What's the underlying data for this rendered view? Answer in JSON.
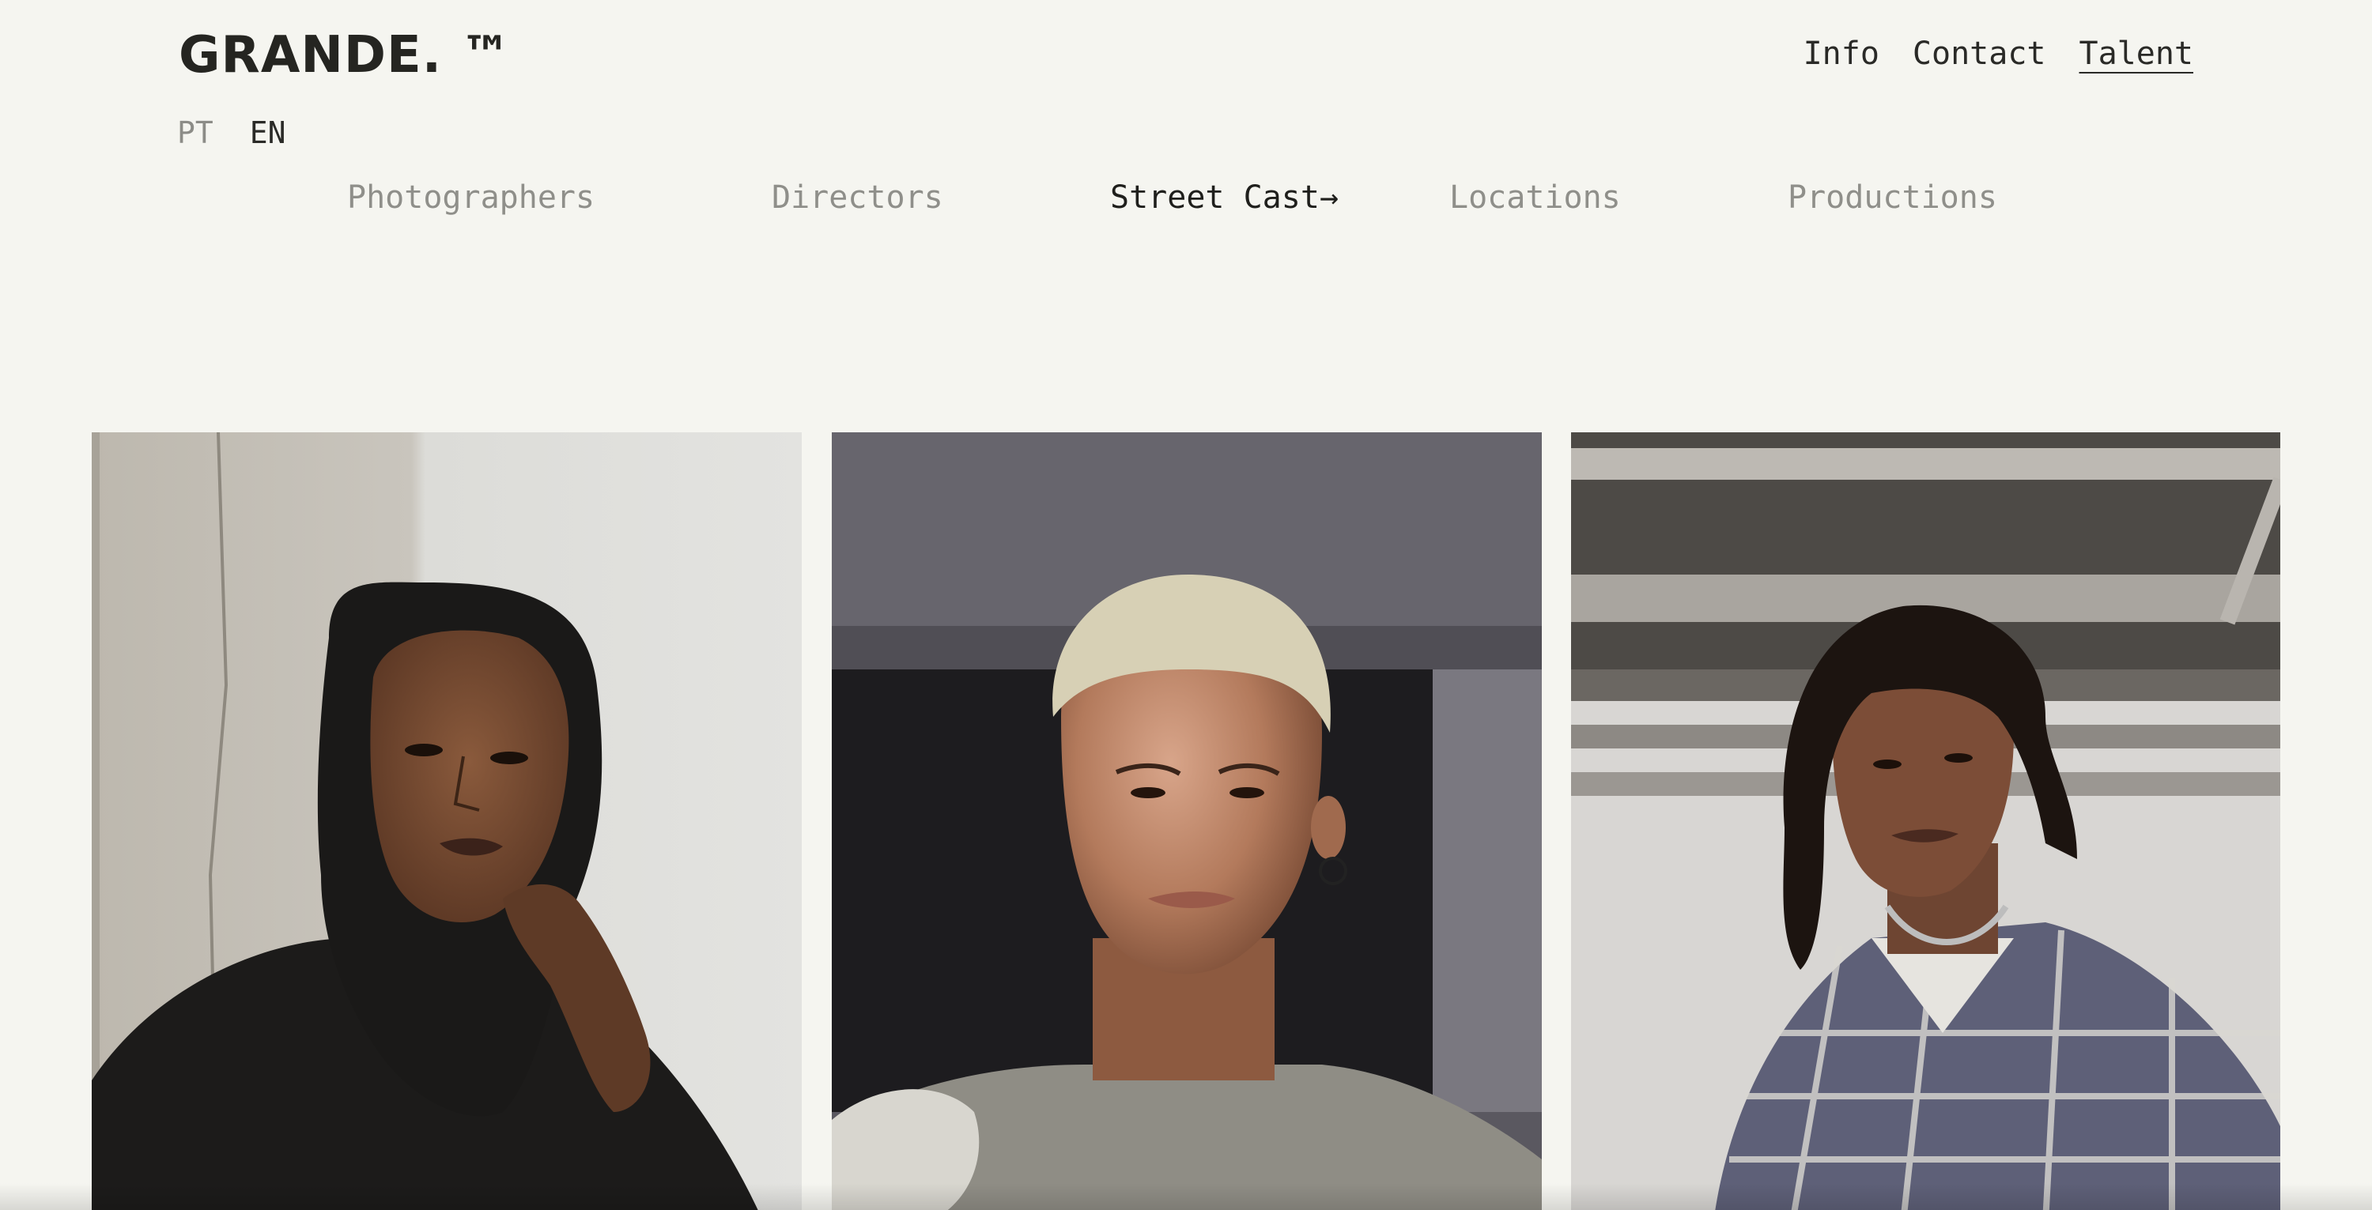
{
  "header": {
    "logo": "GRANDE. ™",
    "nav": [
      {
        "label": "Info"
      },
      {
        "label": "Contact"
      },
      {
        "label": "Talent"
      }
    ]
  },
  "languages": {
    "pt": "PT",
    "en": "EN",
    "selected": "EN"
  },
  "categories": [
    {
      "label": "Photographers"
    },
    {
      "label": "Directors"
    },
    {
      "label": "Street Cast→"
    },
    {
      "label": "Locations"
    },
    {
      "label": "Productions"
    }
  ],
  "colors": {
    "background": "#f5f5f0",
    "text": "#222220",
    "muted": "#8f8f8a"
  },
  "gallery": [
    {
      "subject": "woman in black hijab, hand on chin, light wall background"
    },
    {
      "subject": "man with bleached short hair, nose ring, grey sweater"
    },
    {
      "subject": "man with dreadlocks, plaid shirt, chain necklace, garage ceiling"
    }
  ]
}
